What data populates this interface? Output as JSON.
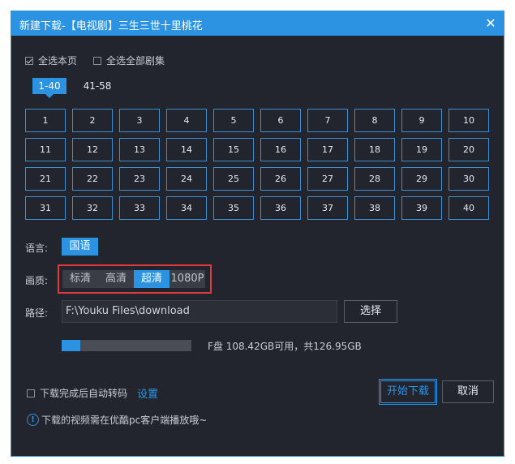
{
  "dialog": {
    "title": "新建下载-【电视剧】三生三世十里桃花",
    "close_glyph": "✕"
  },
  "select_page": {
    "label": "全选本页",
    "checked": true
  },
  "select_all": {
    "label": "全选全部剧集",
    "checked": false
  },
  "range_tabs": [
    {
      "label": "1-40",
      "active": true
    },
    {
      "label": "41-58",
      "active": false
    }
  ],
  "episodes": [
    "1",
    "2",
    "3",
    "4",
    "5",
    "6",
    "7",
    "8",
    "9",
    "10",
    "11",
    "12",
    "13",
    "14",
    "15",
    "16",
    "17",
    "18",
    "19",
    "20",
    "21",
    "22",
    "23",
    "24",
    "25",
    "26",
    "27",
    "28",
    "29",
    "30",
    "31",
    "32",
    "33",
    "34",
    "35",
    "36",
    "37",
    "38",
    "39",
    "40"
  ],
  "language": {
    "label": "语言:",
    "selected": "国语"
  },
  "quality": {
    "label": "画质:",
    "options": [
      "标清",
      "高清",
      "超清",
      "1080P"
    ],
    "selected": "超清"
  },
  "path": {
    "label": "路径:",
    "value": "F:\\Youku Files\\download",
    "choose_label": "选择"
  },
  "disk": {
    "used_fraction": 0.145,
    "text": "F盘 108.42GB可用，共126.95GB"
  },
  "auto_convert": {
    "label": "下载完成后自动转码",
    "checked": false
  },
  "settings_link": "设置",
  "start_button": "开始下载",
  "cancel_button": "取消",
  "info": {
    "icon_glyph": "!",
    "text": "下载的视频需在优酷pc客户端播放哦~"
  },
  "colors": {
    "accent": "#2c93e3",
    "background": "#22252e",
    "highlight": "#e23b3b"
  }
}
